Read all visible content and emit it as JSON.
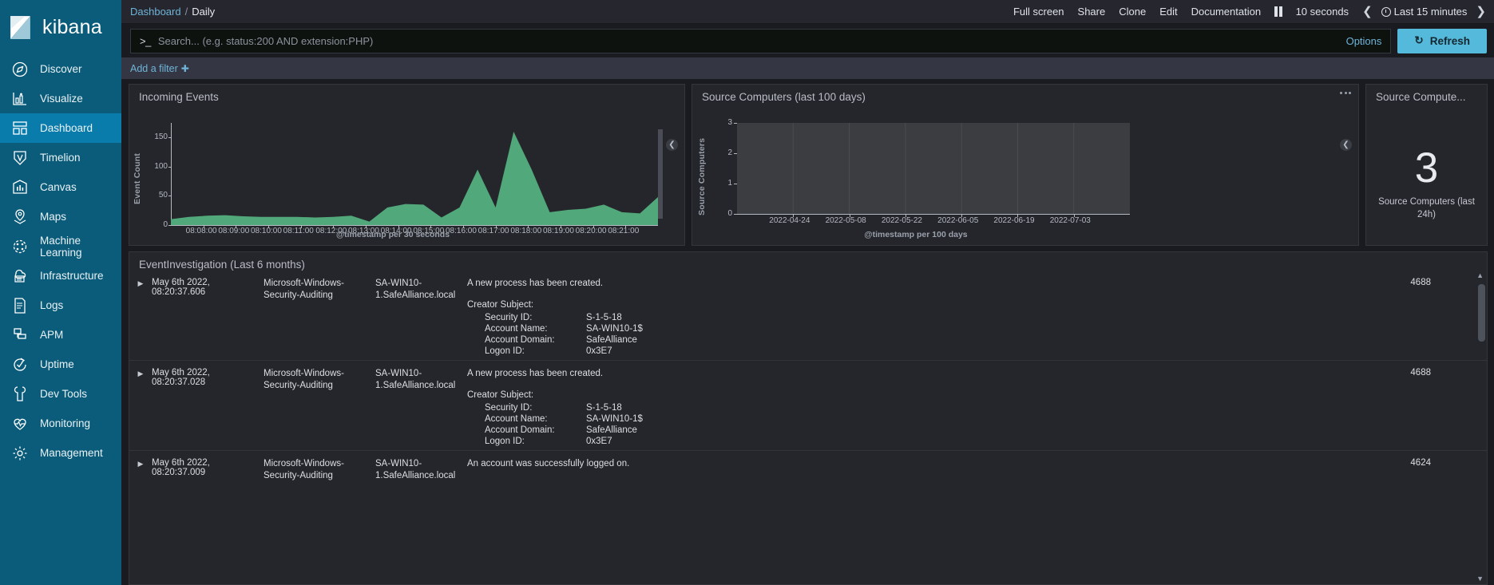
{
  "brand": {
    "name": "kibana"
  },
  "sidebar": {
    "items": [
      {
        "label": "Discover",
        "icon": "compass-icon",
        "active": false
      },
      {
        "label": "Visualize",
        "icon": "bar-chart-icon",
        "active": false
      },
      {
        "label": "Dashboard",
        "icon": "dashboard-icon",
        "active": true
      },
      {
        "label": "Timelion",
        "icon": "timelion-icon",
        "active": false
      },
      {
        "label": "Canvas",
        "icon": "canvas-icon",
        "active": false
      },
      {
        "label": "Maps",
        "icon": "map-pin-icon",
        "active": false
      },
      {
        "label": "Machine Learning",
        "icon": "machine-learning-icon",
        "active": false
      },
      {
        "label": "Infrastructure",
        "icon": "infrastructure-icon",
        "active": false
      },
      {
        "label": "Logs",
        "icon": "logs-icon",
        "active": false
      },
      {
        "label": "APM",
        "icon": "apm-icon",
        "active": false
      },
      {
        "label": "Uptime",
        "icon": "uptime-icon",
        "active": false
      },
      {
        "label": "Dev Tools",
        "icon": "wrench-icon",
        "active": false
      },
      {
        "label": "Monitoring",
        "icon": "heartbeat-icon",
        "active": false
      },
      {
        "label": "Management",
        "icon": "gear-icon",
        "active": false
      }
    ]
  },
  "topbar": {
    "breadcrumb_root": "Dashboard",
    "breadcrumb_sep": "/",
    "breadcrumb_current": "Daily",
    "full_screen": "Full screen",
    "share": "Share",
    "clone": "Clone",
    "edit": "Edit",
    "documentation": "Documentation",
    "pause_icon": "pause-icon",
    "refresh_interval": "10 seconds",
    "prev_icon": "chevron-left-icon",
    "clock_icon": "clock-icon",
    "time_range": "Last 15 minutes",
    "next_icon": "chevron-right-icon"
  },
  "query": {
    "prompt": ">_",
    "value": "",
    "placeholder": "Search... (e.g. status:200 AND extension:PHP)",
    "options_label": "Options",
    "refresh_label": "Refresh",
    "refresh_icon": "refresh-icon"
  },
  "filters": {
    "add_filter_label": "Add a filter",
    "plus_icon": "plus-icon"
  },
  "panels": {
    "incoming": {
      "title": "Incoming Events",
      "collapse_icon": "chevron-left-icon"
    },
    "source": {
      "title": "Source Computers (last 100 days)",
      "menu_icon": "ellipsis-icon",
      "collapse_icon": "chevron-left-icon"
    },
    "metric": {
      "title": "Source Compute...",
      "value": "3",
      "label": "Source Computers (last 24h)"
    },
    "table": {
      "title": "EventInvestigation (Last 6 months)",
      "scroll_up_icon": "caret-up-icon",
      "scroll_down_icon": "caret-down-icon"
    }
  },
  "chart_data": [
    {
      "type": "area",
      "title": "Incoming Events",
      "xlabel": "@timestamp per 30 seconds",
      "ylabel": "Event Count",
      "ylim": [
        0,
        175
      ],
      "yticks": [
        0,
        50,
        100,
        150
      ],
      "grid": false,
      "color": "#51a87a",
      "xticks": [
        "08:08:00",
        "08:09:00",
        "08:10:00",
        "08:11:00",
        "08:12:00",
        "08:13:00",
        "08:14:00",
        "08:15:00",
        "08:16:00",
        "08:17:00",
        "08:18:00",
        "08:19:00",
        "08:20:00",
        "08:21:00"
      ],
      "x": [
        "08:07:30",
        "08:08:00",
        "08:08:30",
        "08:09:00",
        "08:09:30",
        "08:10:00",
        "08:10:30",
        "08:11:00",
        "08:11:30",
        "08:12:00",
        "08:12:30",
        "08:13:00",
        "08:13:30",
        "08:14:00",
        "08:14:30",
        "08:15:00",
        "08:15:30",
        "08:16:00",
        "08:16:30",
        "08:17:00",
        "08:17:30",
        "08:18:00",
        "08:18:30",
        "08:19:00",
        "08:19:30",
        "08:20:00",
        "08:20:30",
        "08:21:00"
      ],
      "values": [
        10,
        14,
        16,
        17,
        15,
        14,
        14,
        14,
        13,
        14,
        16,
        6,
        30,
        36,
        35,
        13,
        30,
        95,
        30,
        160,
        95,
        22,
        26,
        28,
        35,
        22,
        20,
        48
      ]
    },
    {
      "type": "area",
      "title": "Source Computers (last 100 days)",
      "xlabel": "@timestamp per 100 days",
      "ylabel": "Source Computers",
      "ylim": [
        0,
        3
      ],
      "yticks": [
        0,
        1,
        2,
        3
      ],
      "grid": true,
      "color": "#51a87a",
      "xticks": [
        "2022-04-24",
        "2022-05-08",
        "2022-05-22",
        "2022-06-05",
        "2022-06-19",
        "2022-07-03"
      ],
      "x": [],
      "values": []
    }
  ],
  "events": {
    "rows": [
      {
        "expand_icon": "caret-right-icon",
        "time": "May 6th 2022, 08:20:37.606",
        "provider": "Microsoft-Windows-Security-Auditing",
        "host": "SA-WIN10-1.SafeAlliance.local",
        "message": "A new process has been created.",
        "detail_header": "Creator Subject:",
        "details": [
          {
            "key": "Security ID:",
            "value": "S-1-5-18"
          },
          {
            "key": "Account Name:",
            "value": "SA-WIN10-1$"
          },
          {
            "key": "Account Domain:",
            "value": "SafeAlliance"
          },
          {
            "key": "Logon ID:",
            "value": "0x3E7"
          }
        ],
        "code": "4688"
      },
      {
        "expand_icon": "caret-right-icon",
        "time": "May 6th 2022, 08:20:37.028",
        "provider": "Microsoft-Windows-Security-Auditing",
        "host": "SA-WIN10-1.SafeAlliance.local",
        "message": "A new process has been created.",
        "detail_header": "Creator Subject:",
        "details": [
          {
            "key": "Security ID:",
            "value": "S-1-5-18"
          },
          {
            "key": "Account Name:",
            "value": "SA-WIN10-1$"
          },
          {
            "key": "Account Domain:",
            "value": "SafeAlliance"
          },
          {
            "key": "Logon ID:",
            "value": "0x3E7"
          }
        ],
        "code": "4688"
      },
      {
        "expand_icon": "caret-right-icon",
        "time": "May 6th 2022, 08:20:37.009",
        "provider": "Microsoft-Windows-Security-Auditing",
        "host": "SA-WIN10-1.SafeAlliance.local",
        "message": "An account was successfully logged on.",
        "detail_header": "",
        "details": [],
        "code": "4624"
      }
    ]
  },
  "colors": {
    "sidebar": "#0b5c7a",
    "sidebar_active": "#0a7cab",
    "accent_link": "#6fb4d8",
    "refresh_button": "#54b9db",
    "chart_green": "#51a87a",
    "panel_bg": "#25262b"
  }
}
